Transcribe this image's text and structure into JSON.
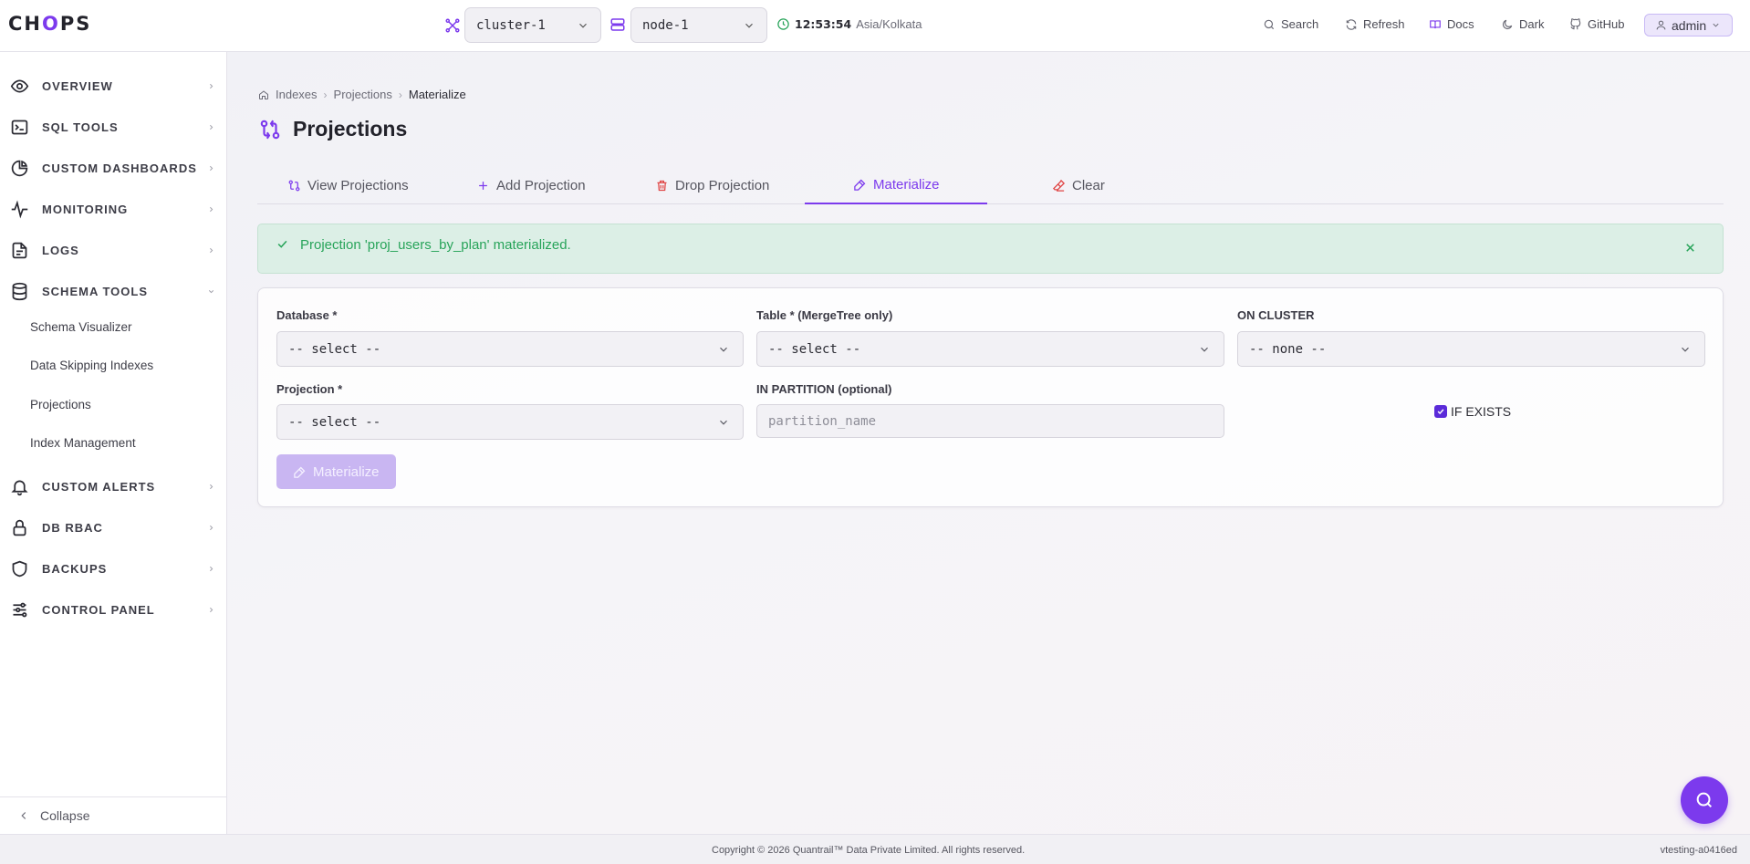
{
  "app": {
    "logo_text_1": "CH",
    "logo_text_2": "O",
    "logo_text_3": "PS"
  },
  "topbar": {
    "cluster_select": "cluster-1",
    "node_select": "node-1",
    "time": "12:53:54",
    "timezone": "Asia/Kolkata",
    "search_label": "Search",
    "refresh_label": "Refresh",
    "docs_label": "Docs",
    "theme_label": "Dark",
    "github_label": "GitHub",
    "user_label": "admin"
  },
  "sidebar": {
    "items": [
      {
        "label": "OVERVIEW",
        "icon": "eye-icon"
      },
      {
        "label": "SQL TOOLS",
        "icon": "terminal-icon"
      },
      {
        "label": "CUSTOM DASHBOARDS",
        "icon": "pie-chart-icon"
      },
      {
        "label": "MONITORING",
        "icon": "activity-icon"
      },
      {
        "label": "LOGS",
        "icon": "file-icon"
      },
      {
        "label": "SCHEMA TOOLS",
        "icon": "database-icon"
      },
      {
        "label": "CUSTOM ALERTS",
        "icon": "bell-icon"
      },
      {
        "label": "DB RBAC",
        "icon": "lock-icon"
      },
      {
        "label": "BACKUPS",
        "icon": "shield-icon"
      },
      {
        "label": "CONTROL PANEL",
        "icon": "sliders-icon"
      }
    ],
    "sub_items": [
      "Schema Visualizer",
      "Data Skipping Indexes",
      "Projections",
      "Index Management"
    ],
    "collapse_label": "Collapse"
  },
  "breadcrumb": {
    "items": [
      "Indexes",
      "Projections",
      "Materialize"
    ]
  },
  "page": {
    "title": "Projections"
  },
  "tabs": [
    {
      "label": "View Projections",
      "icon": "projection-icon",
      "active": false
    },
    {
      "label": "Add Projection",
      "icon": "plus-icon",
      "active": false
    },
    {
      "label": "Drop Projection",
      "icon": "trash-icon",
      "active": false
    },
    {
      "label": "Materialize",
      "icon": "hammer-icon",
      "active": true
    },
    {
      "label": "Clear",
      "icon": "eraser-icon",
      "active": false
    }
  ],
  "alert": {
    "message": "Projection 'proj_users_by_plan' materialized.",
    "status_color": "#28a45a"
  },
  "form": {
    "database_label": "Database *",
    "database_value": "-- select --",
    "table_label": "Table * (MergeTree only)",
    "table_value": "-- select --",
    "cluster_label": "ON CLUSTER",
    "cluster_value": "-- none --",
    "projection_label": "Projection *",
    "projection_value": "-- select --",
    "partition_label": "IN PARTITION (optional)",
    "partition_placeholder": "partition_name",
    "if_exists_label": "IF EXISTS",
    "if_exists_checked": true,
    "submit_label": "Materialize"
  },
  "footer": {
    "copyright": "Copyright © 2026 Quantrail™ Data Private Limited. All rights reserved.",
    "version": "vtesting-a0416ed"
  },
  "colors": {
    "accent": "#7c3aed",
    "success": "#28a45a",
    "danger": "#e04444"
  }
}
